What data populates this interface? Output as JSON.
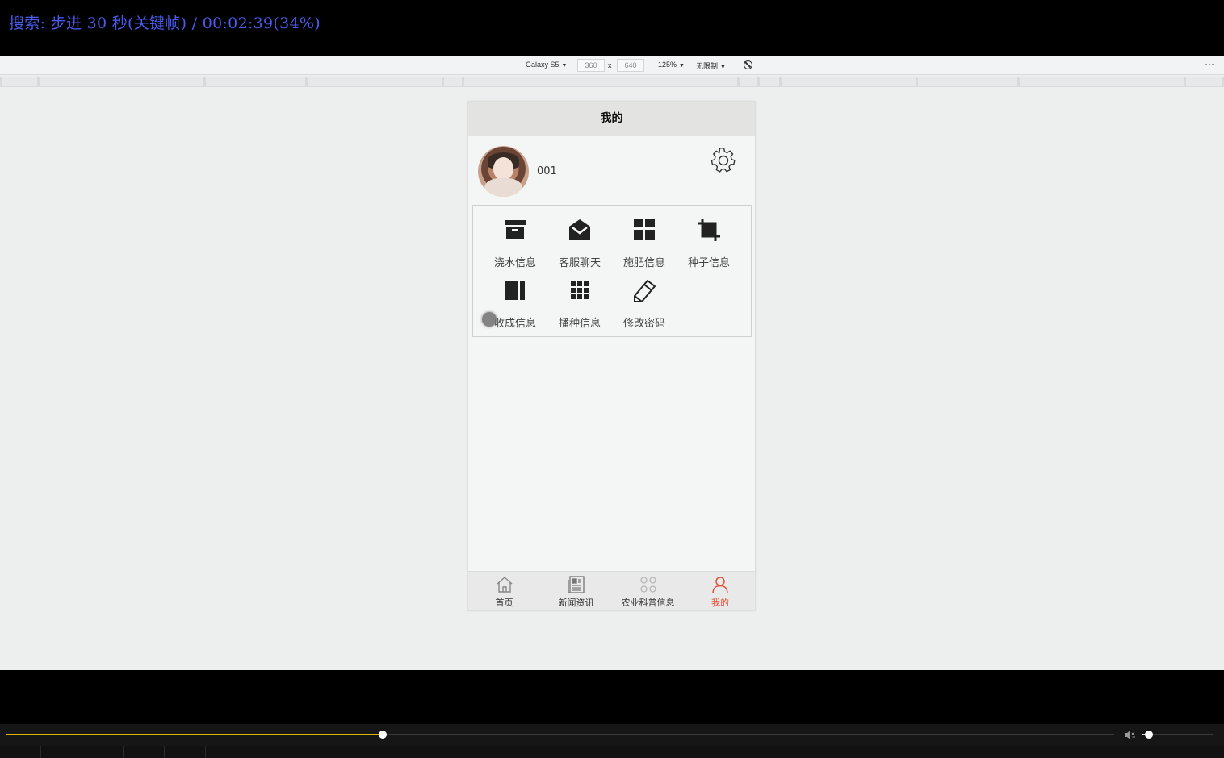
{
  "osd": {
    "text": "搜索: 步进 30 秒(关键帧) / 00:02:39(34%)"
  },
  "device_toolbar": {
    "device": "Galaxy S5",
    "width": "360",
    "times": "x",
    "height": "640",
    "zoom": "125%",
    "throttle": "无限制",
    "more": "⋮"
  },
  "app": {
    "title": "我的",
    "username": "001",
    "menu": [
      {
        "label": "浇水信息",
        "icon": "archive-icon"
      },
      {
        "label": "客服聊天",
        "icon": "envelope-icon"
      },
      {
        "label": "施肥信息",
        "icon": "dashboard-grid-icon"
      },
      {
        "label": "种子信息",
        "icon": "crop-icon"
      },
      {
        "label": "收成信息",
        "icon": "columns-icon"
      },
      {
        "label": "播种信息",
        "icon": "apps-grid-icon"
      },
      {
        "label": "修改密码",
        "icon": "pencil-icon"
      }
    ],
    "tabs": [
      {
        "label": "首页",
        "icon": "home-icon",
        "active": false
      },
      {
        "label": "新闻资讯",
        "icon": "newspaper-icon",
        "active": false
      },
      {
        "label": "农业科普信息",
        "icon": "clover-icon",
        "active": false
      },
      {
        "label": "我的",
        "icon": "user-icon",
        "active": true
      }
    ],
    "active_color": "#e0533a"
  },
  "player": {
    "progress": 0.34,
    "volume": 0.1,
    "progress_color": "#d8b700"
  }
}
